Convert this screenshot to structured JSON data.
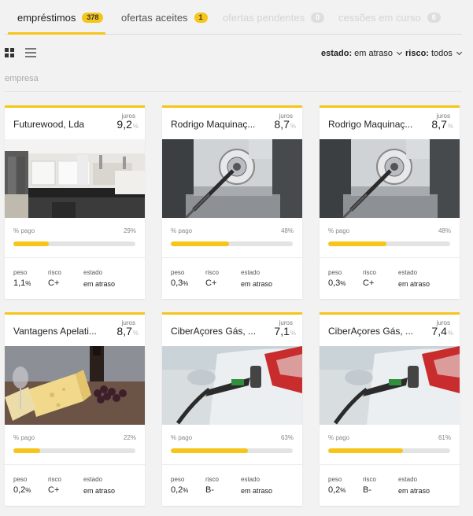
{
  "tabs": [
    {
      "label": "empréstimos",
      "count": "378",
      "state": "active"
    },
    {
      "label": "ofertas aceites",
      "count": "1",
      "state": "normal"
    },
    {
      "label": "ofertas pendentes",
      "count": "0",
      "state": "disabled"
    },
    {
      "label": "cessões em curso",
      "count": "0",
      "state": "disabled"
    }
  ],
  "view_icons": [
    "grid-view-icon",
    "list-view-icon"
  ],
  "filters": {
    "estado": {
      "label": "estado:",
      "value": "em atraso"
    },
    "risco": {
      "label": "risco:",
      "value": "todos"
    }
  },
  "column_label": "empresa",
  "labels": {
    "juros": "juros",
    "pago": "% pago",
    "peso": "peso",
    "risco": "risco",
    "estado": "estado",
    "pct": "%"
  },
  "colors": {
    "accent": "#f5c518",
    "background": "#f2f2f2"
  },
  "cards": [
    {
      "name": "Futurewood, Lda",
      "juros": "9,2",
      "pago": "29%",
      "pago_fraction": 0.29,
      "peso": "1,1",
      "risco": "C+",
      "estado": "em atraso",
      "image": "kitchen-interior-photo"
    },
    {
      "name": "Rodrigo Maquinaç...",
      "juros": "8,7",
      "pago": "48%",
      "pago_fraction": 0.48,
      "peso": "0,3",
      "risco": "C+",
      "estado": "em atraso",
      "image": "cnc-drill-machine-photo"
    },
    {
      "name": "Rodrigo Maquinaç...",
      "juros": "8,7",
      "pago": "48%",
      "pago_fraction": 0.48,
      "peso": "0,3",
      "risco": "C+",
      "estado": "em atraso",
      "image": "cnc-drill-machine-photo"
    },
    {
      "name": "Vantagens Apelati...",
      "juros": "8,7",
      "pago": "22%",
      "pago_fraction": 0.22,
      "peso": "0,2",
      "risco": "C+",
      "estado": "em atraso",
      "image": "cheese-wine-photo"
    },
    {
      "name": "CiberAçores Gás, ...",
      "juros": "7,1",
      "pago": "63%",
      "pago_fraction": 0.63,
      "peso": "0,2",
      "risco": "B-",
      "estado": "em atraso",
      "image": "fuel-nozzle-car-photo"
    },
    {
      "name": "CiberAçores Gás, ...",
      "juros": "7,4",
      "pago": "61%",
      "pago_fraction": 0.61,
      "peso": "0,2",
      "risco": "B-",
      "estado": "em atraso",
      "image": "fuel-nozzle-car-photo"
    }
  ]
}
